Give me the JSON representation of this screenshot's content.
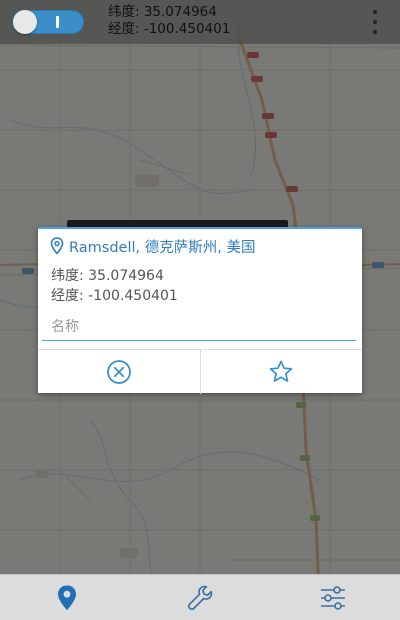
{
  "colors": {
    "accent": "#2f7fc0",
    "toggle_on": "#3b8fc9",
    "field_underline": "#4aa3df",
    "map_base": "#e9e8df",
    "bottom_bar": "#dcdcdc"
  },
  "topbar": {
    "toggle_state": "on",
    "latitude_text": "纬度: 35.074964",
    "longitude_text": "经度: -100.450401",
    "overflow_icon": "more-vert-icon"
  },
  "dialog": {
    "title_icon": "location-pin-outline-icon",
    "title": "Ramsdell, 德克萨斯州, 美国",
    "latitude_text": "纬度: 35.074964",
    "longitude_text": "经度: -100.450401",
    "name_field": {
      "value": "",
      "placeholder": "名称"
    },
    "cancel_icon": "close-circle-icon",
    "favorite_icon": "star-outline-icon"
  },
  "bottom_nav": {
    "items": [
      {
        "icon": "location-pin-icon",
        "active": true
      },
      {
        "icon": "wrench-icon",
        "active": false
      },
      {
        "icon": "sliders-icon",
        "active": false
      }
    ]
  }
}
